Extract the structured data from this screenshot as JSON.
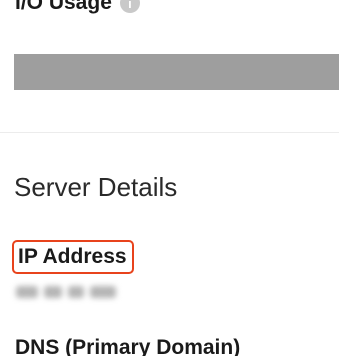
{
  "usage": {
    "label": "I/O Usage",
    "info_icon": "info-icon",
    "info_glyph": "i",
    "percent": 100
  },
  "server_details": {
    "title": "Server Details",
    "ip_address": {
      "label": "IP Address",
      "value_state": "redacted",
      "highlight_color": "#e8431c"
    },
    "dns": {
      "label": "DNS (Primary Domain)"
    }
  }
}
